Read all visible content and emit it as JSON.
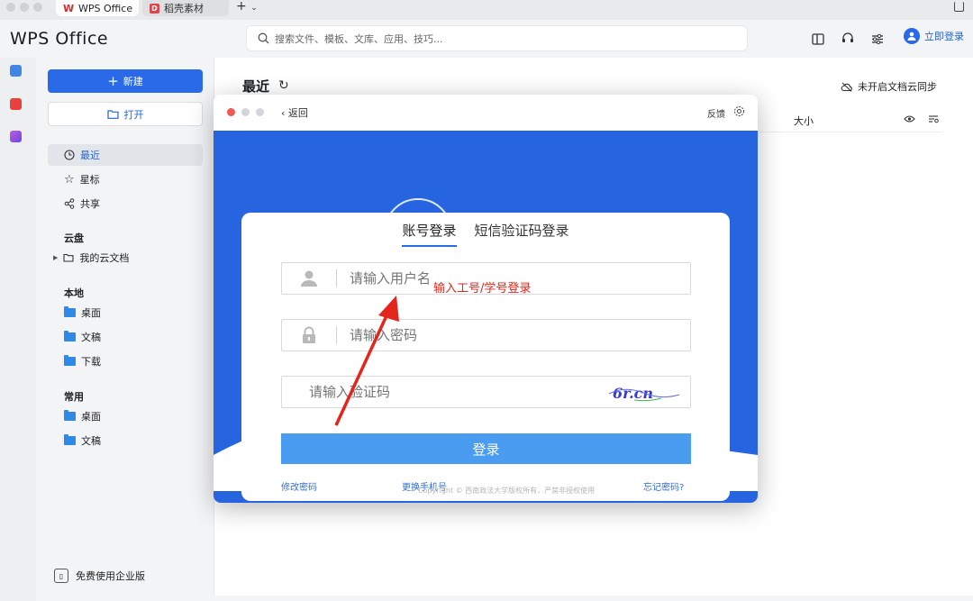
{
  "tabs": [
    {
      "label": "WPS Office",
      "logo": "W"
    },
    {
      "label": "稻壳素材",
      "logo": "D"
    }
  ],
  "header": {
    "brand": "WPS Office",
    "search_placeholder": "搜索文件、模板、文库、应用、技巧...",
    "login_label": "立即登录"
  },
  "sidebar": {
    "new_label": "新建",
    "open_label": "打开",
    "nav": [
      "最近",
      "星标",
      "共享"
    ],
    "cloud_section": "云盘",
    "cloud_item": "我的云文档",
    "local_section": "本地",
    "local_items": [
      "桌面",
      "文稿",
      "下载"
    ],
    "common_section": "常用",
    "common_items": [
      "桌面",
      "文稿"
    ],
    "enterprise_label": "免费使用企业版"
  },
  "main": {
    "title": "最近",
    "sync_label": "未开启文档云同步",
    "col_size": "大小"
  },
  "dialog": {
    "back_label": "返回",
    "feedback_label": "反馈",
    "tab_account": "账号登录",
    "tab_sms": "短信验证码登录",
    "username_placeholder": "请输入用户名",
    "password_placeholder": "请输入密码",
    "captcha_placeholder": "请输入验证码",
    "captcha_text": "6r.cn",
    "submit_label": "登录",
    "link_change_password": "修改密码",
    "link_change_phone": "更换手机号",
    "link_forgot": "忘记密码?",
    "copyright": "Copyright © 西南政法大学版权所有，严禁非授权使用"
  },
  "annotation": {
    "text": "输入工号/学号登录",
    "color": "#e3251b"
  },
  "colors": {
    "accent": "#2a6ae8",
    "banner": "#2764e0",
    "submit": "#4a9cf0"
  }
}
